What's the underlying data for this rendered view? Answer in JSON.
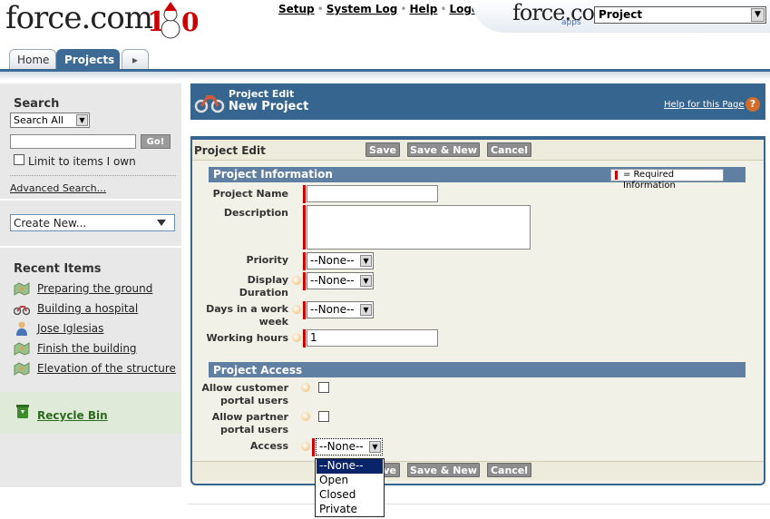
{
  "header": {
    "logo_text": "force.com",
    "top_links": [
      "Setup",
      "System Log",
      "Help",
      "Logout"
    ],
    "app_logo_text": "force.com",
    "app_logo_sub": "apps",
    "app_selector_value": "Project"
  },
  "tabs": [
    {
      "label": "Home"
    },
    {
      "label": "Projects"
    },
    {
      "label": "▸"
    }
  ],
  "sidebar": {
    "search_title": "Search",
    "search_scope": "Search All",
    "search_value": "",
    "go_label": "Go!",
    "limit_label": "Limit to items I own",
    "advanced_search": "Advanced Search...",
    "create_new": "Create New...",
    "recent_title": "Recent Items",
    "recent_items": [
      {
        "label": "Preparing the ground",
        "icon": "map-icon"
      },
      {
        "label": "Building a hospital",
        "icon": "motorcycle-icon"
      },
      {
        "label": "Jose Iglesias",
        "icon": "person-icon"
      },
      {
        "label": "Finish the building",
        "icon": "map-icon"
      },
      {
        "label": "Elevation of the structure",
        "icon": "map-icon"
      }
    ],
    "recycle_bin": "Recycle Bin"
  },
  "page_header": {
    "type": "Project Edit",
    "title": "New Project",
    "help_link": "Help for this Page",
    "help_icon": "?"
  },
  "form": {
    "title": "Project Edit",
    "buttons": {
      "save": "Save",
      "save_new": "Save & New",
      "cancel": "Cancel"
    },
    "section_info": "Project Information",
    "required_legend": "= Required Information",
    "fields": {
      "project_name": {
        "label": "Project Name",
        "value": ""
      },
      "description": {
        "label": "Description",
        "value": ""
      },
      "priority": {
        "label": "Priority",
        "value": "--None--"
      },
      "display_duration": {
        "label": "Display Duration",
        "value": "--None--"
      },
      "days_in_week": {
        "label": "Days in a work week",
        "value": "--None--"
      },
      "working_hours": {
        "label": "Working hours",
        "value": "1"
      }
    },
    "section_access": "Project Access",
    "access_fields": {
      "allow_customer": {
        "label": "Allow customer portal users",
        "checked": false
      },
      "allow_partner": {
        "label": "Allow partner portal users",
        "checked": false
      },
      "access": {
        "label": "Access",
        "value": "--None--"
      }
    },
    "access_options": [
      "--None--",
      "Open",
      "Closed",
      "Private"
    ]
  },
  "colors": {
    "brand_blue": "#36658f",
    "section_blue": "#5f7fa3",
    "required_red": "#cc0000"
  }
}
